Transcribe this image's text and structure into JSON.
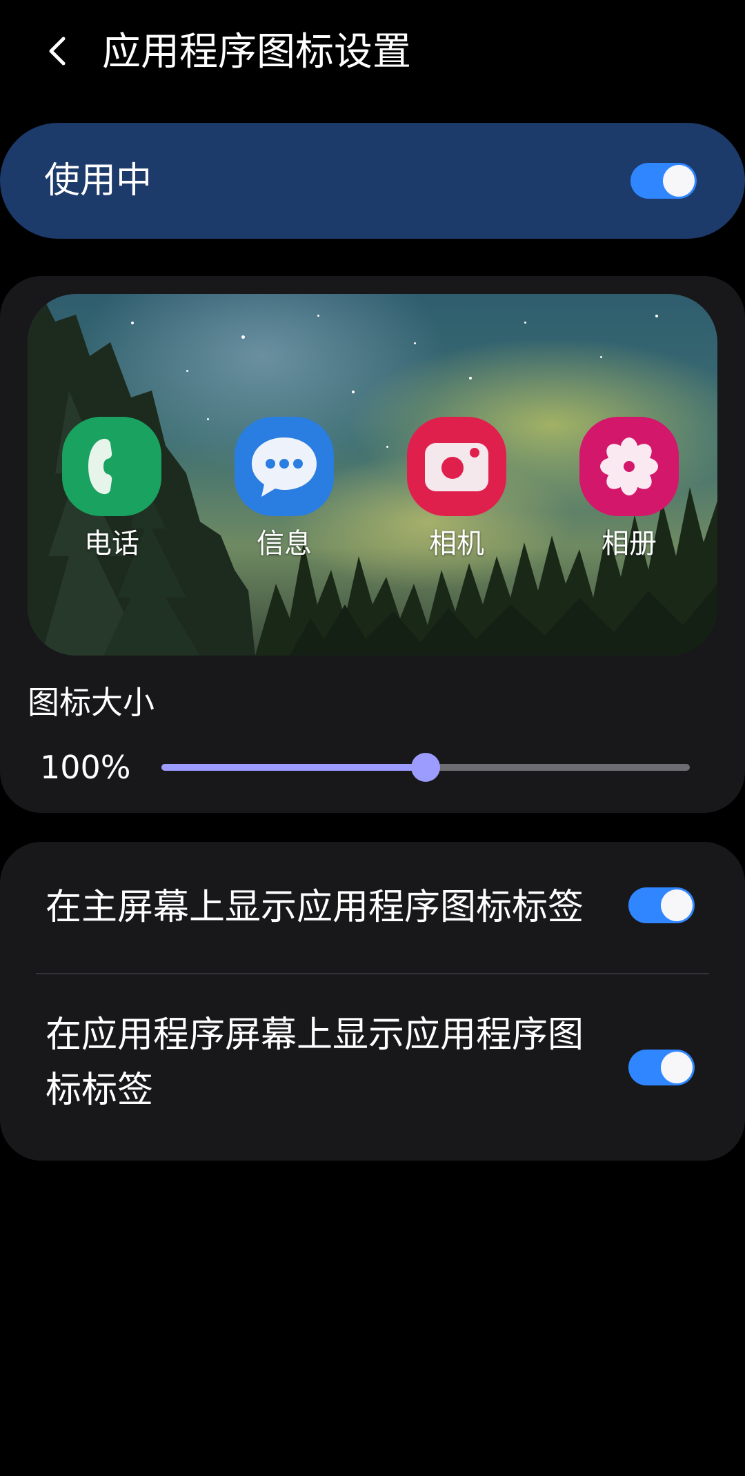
{
  "header": {
    "title": "应用程序图标设置",
    "back_icon": "chevron-left-icon"
  },
  "master_switch": {
    "label": "使用中",
    "on": true
  },
  "preview": {
    "apps": [
      {
        "label": "电话",
        "icon": "phone-icon",
        "color": "#1aa260"
      },
      {
        "label": "信息",
        "icon": "message-icon",
        "color": "#2a7de1"
      },
      {
        "label": "相机",
        "icon": "camera-icon",
        "color": "#e0204c"
      },
      {
        "label": "相册",
        "icon": "gallery-icon",
        "color": "#d3176b"
      }
    ]
  },
  "icon_size": {
    "label": "图标大小",
    "value_text": "100%",
    "slider_level": 0.5
  },
  "settings": {
    "home_labels": {
      "label": "在主屏幕上显示应用程序图标标签",
      "on": true
    },
    "apps_labels": {
      "label": "在应用程序屏幕上显示应用程序图标标签",
      "on": true
    }
  },
  "colors": {
    "accent": "#2f86ff",
    "slider": "#9c9cff",
    "master_card": "#1c3a6a",
    "card": "#18181b"
  }
}
